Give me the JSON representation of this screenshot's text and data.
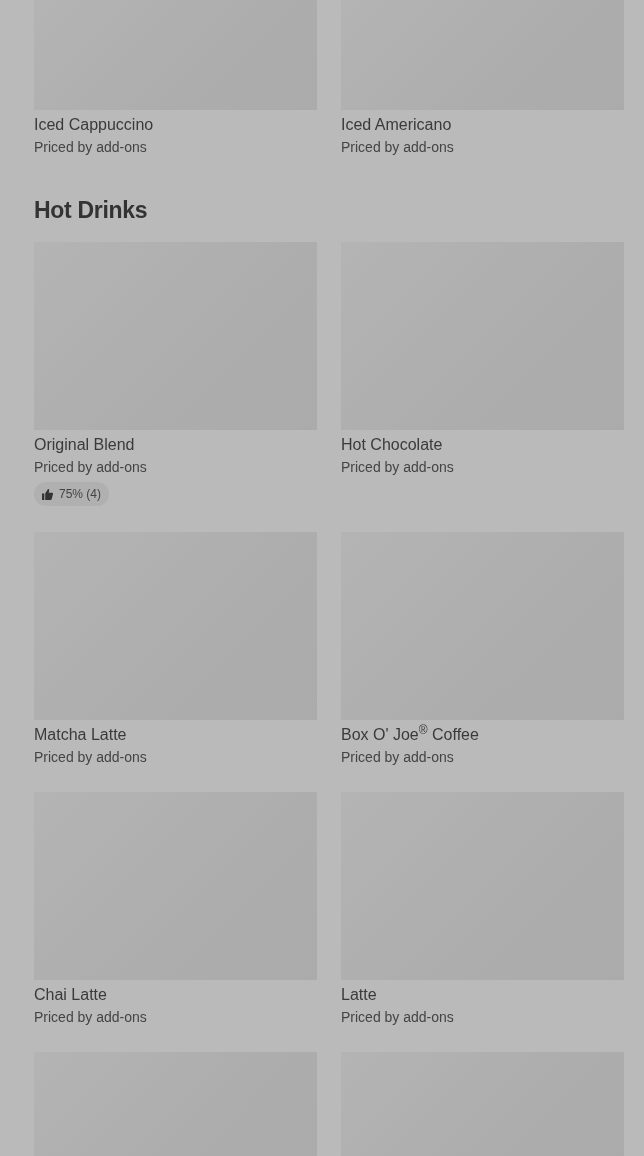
{
  "sections": [
    {
      "items": [
        {
          "kind": "card",
          "name": "Iced Cappuccino",
          "price": "Priced by add-ons"
        },
        {
          "kind": "card",
          "name": "Iced Americano",
          "price": "Priced by add-ons"
        }
      ]
    },
    {
      "title": "Hot Drinks",
      "items": [
        {
          "kind": "card",
          "name": "Original Blend",
          "price": "Priced by add-ons",
          "rating": "75% (4)"
        },
        {
          "kind": "card",
          "name": "Hot Chocolate",
          "price": "Priced by add-ons"
        },
        {
          "kind": "card",
          "name": "Matcha Latte",
          "price": "Priced by add-ons"
        },
        {
          "kind": "card",
          "name": "Box O' Joe$^{®}$ Coffee",
          "price": "Priced by add-ons"
        },
        {
          "kind": "card",
          "name": "Chai Latte",
          "price": "Priced by add-ons"
        },
        {
          "kind": "card",
          "name": "Latte",
          "price": "Priced by add-ons"
        },
        {
          "kind": "image-only"
        },
        {
          "kind": "image-only"
        }
      ]
    }
  ]
}
